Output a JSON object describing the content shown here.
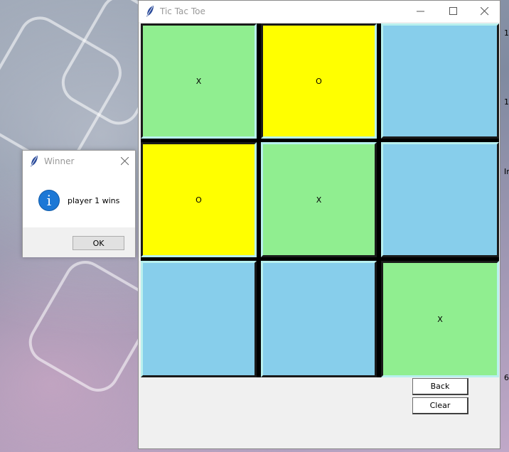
{
  "window": {
    "title": "Tic Tac Toe"
  },
  "board": {
    "cells": [
      {
        "mark": "X",
        "color": "#90ee90"
      },
      {
        "mark": "O",
        "color": "#ffff00"
      },
      {
        "mark": "",
        "color": "#87ceeb"
      },
      {
        "mark": "O",
        "color": "#ffff00"
      },
      {
        "mark": "X",
        "color": "#90ee90"
      },
      {
        "mark": "",
        "color": "#87ceeb"
      },
      {
        "mark": "",
        "color": "#87ceeb"
      },
      {
        "mark": "",
        "color": "#87ceeb"
      },
      {
        "mark": "X",
        "color": "#90ee90"
      }
    ]
  },
  "controls": {
    "back_label": "Back",
    "clear_label": "Clear"
  },
  "dialog": {
    "title": "Winner",
    "message": "player 1 wins",
    "ok_label": "OK",
    "icon": "info-icon"
  },
  "edge_fragments": [
    "1",
    "1",
    "Ir",
    "6"
  ]
}
